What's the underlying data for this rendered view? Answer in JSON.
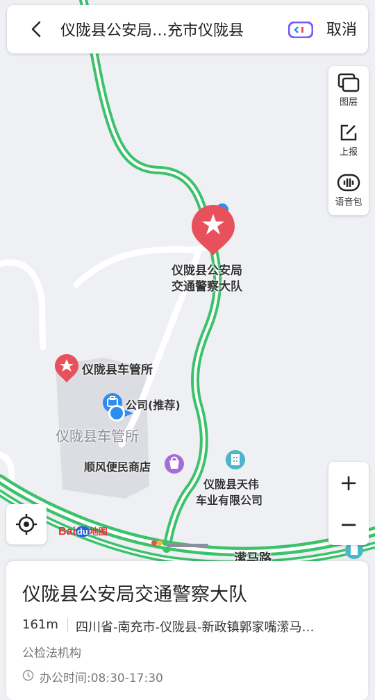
{
  "search": {
    "query": "仪陇县公安局…充市仪陇县",
    "cancel_label": "取消"
  },
  "tools": [
    {
      "label": "图层"
    },
    {
      "label": "上报"
    },
    {
      "label": "语音包"
    }
  ],
  "zoom": {
    "in": "+",
    "out": "−"
  },
  "map": {
    "pins": {
      "police_line1": "仪陇县公安局",
      "police_line2": "交通警察大队",
      "dmv": "仪陇县车管所"
    },
    "labels": {
      "company": "公司(推荐)",
      "area": "仪陇县车管所",
      "store": "顺风便民商店",
      "tianwei_line1": "仪陇县天伟",
      "tianwei_line2": "车业有限公司",
      "road": "潆马路"
    },
    "logo": {
      "text1": "Bai",
      "text2": "du",
      "text3": "地图"
    },
    "colors": {
      "route_green": "#3cc26b",
      "pin_red": "#e8505b",
      "blue": "#2b8ef0",
      "store_purple": "#a56bd8",
      "teal": "#4ab6c6"
    }
  },
  "card": {
    "title": "仪陇县公安局交通警察大队",
    "distance": "161m",
    "address": "四川省-南充市-仪陇县-新政镇郭家嘴潆马…",
    "category": "公检法机构",
    "hours": "办公时间:08:30-17:30"
  }
}
